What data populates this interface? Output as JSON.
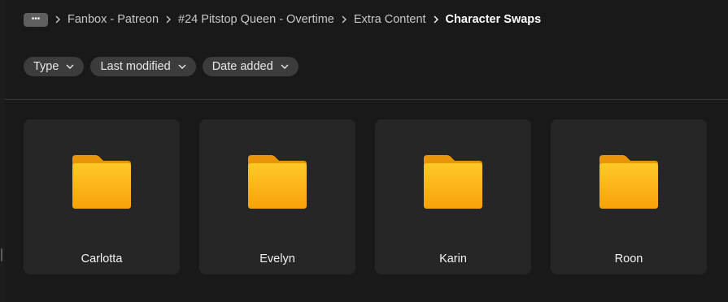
{
  "breadcrumb": {
    "more_label": "•••",
    "items": [
      {
        "label": "Fanbox - Patreon"
      },
      {
        "label": "#24 Pitstop Queen - Overtime"
      },
      {
        "label": "Extra Content"
      },
      {
        "label": "Character Swaps"
      }
    ]
  },
  "filters": [
    {
      "label": "Type"
    },
    {
      "label": "Last modified"
    },
    {
      "label": "Date added"
    }
  ],
  "folders": [
    {
      "name": "Carlotta"
    },
    {
      "name": "Evelyn"
    },
    {
      "name": "Karin"
    },
    {
      "name": "Roon"
    }
  ],
  "colors": {
    "background": "#191919",
    "card": "#262626",
    "chip": "#3c3c3c",
    "folder_top": "#ffc928",
    "folder_bottom": "#f9a20a"
  },
  "icons": {
    "more": "more-horizontal-icon",
    "separator": "chevron-right-icon",
    "filter_caret": "chevron-down-icon",
    "folder": "folder-icon"
  }
}
